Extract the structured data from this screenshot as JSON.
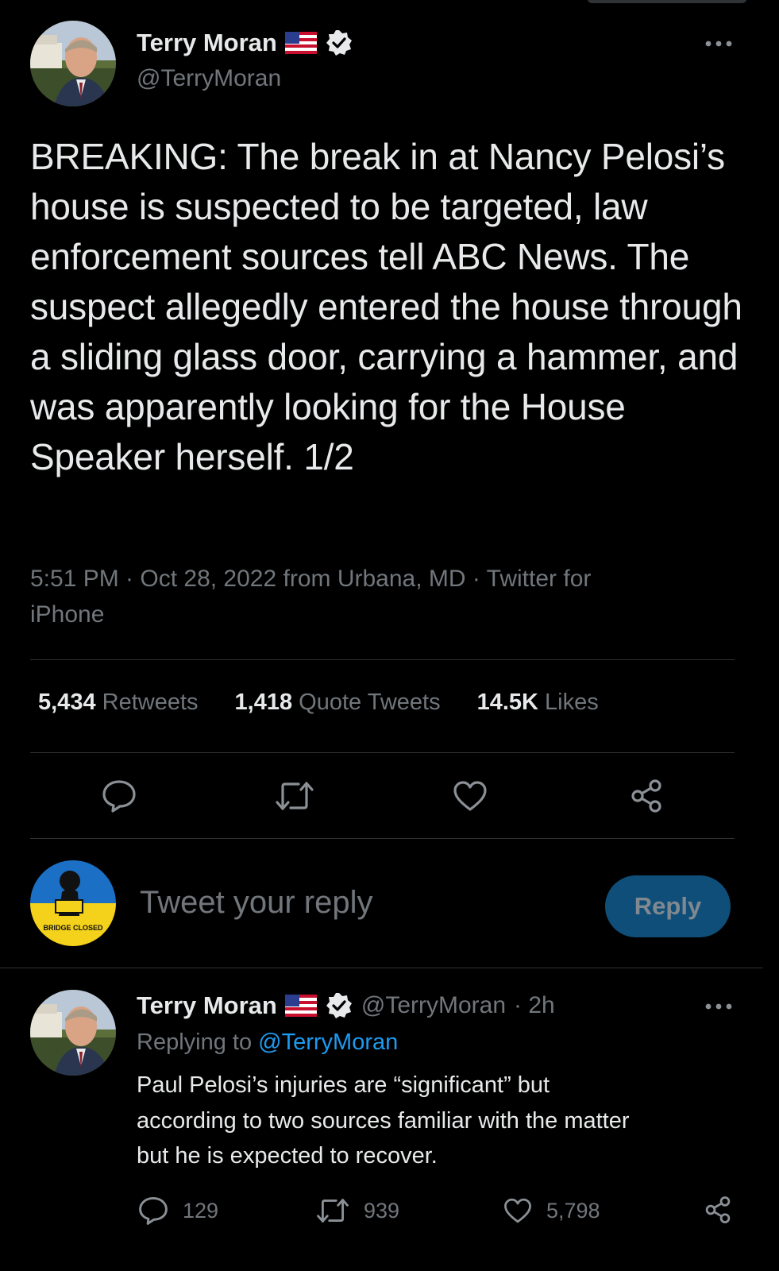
{
  "tweet": {
    "author": {
      "name": "Terry Moran",
      "handle": "@TerryMoran"
    },
    "text": "BREAKING: The break in at Nancy Pelosi’s house is suspected to be targeted, law enforcement sources tell ABC News. The suspect allegedly entered the house through a sliding glass door, carrying a hammer, and was apparently looking for the House Speaker herself. 1/2",
    "meta_line1": "5:51 PM · Oct 28, 2022 from Urbana, MD · Twitter for",
    "meta_line2": "iPhone",
    "stats": [
      {
        "value": "5,434",
        "label": "Retweets"
      },
      {
        "value": "1,418",
        "label": "Quote Tweets"
      },
      {
        "value": "14.5K",
        "label": "Likes"
      }
    ]
  },
  "compose": {
    "placeholder": "Tweet your reply",
    "button_label": "Reply",
    "avatar_text": "BRIDGE CLOSED"
  },
  "reply": {
    "author": {
      "name": "Terry Moran",
      "handle": "@TerryMoran",
      "time": "· 2h"
    },
    "replying_prefix": "Replying to",
    "replying_handle": "@TerryMoran",
    "text": "Paul Pelosi’s injuries are “significant” but\n according to two sources familiar with the matter\nbut he is expected to recover.",
    "counts": {
      "replies": "129",
      "retweets": "939",
      "likes": "5,798"
    }
  },
  "colors": {
    "background": "#000000",
    "text_primary": "#e7e9ea",
    "text_secondary": "#71767b",
    "link": "#1d9bf0",
    "divider": "#2f3336",
    "reply_button": "#0f4e78"
  },
  "icons": [
    "us-flag-icon",
    "verified-badge-icon",
    "more-icon",
    "reply-icon",
    "retweet-icon",
    "like-icon",
    "share-icon"
  ]
}
